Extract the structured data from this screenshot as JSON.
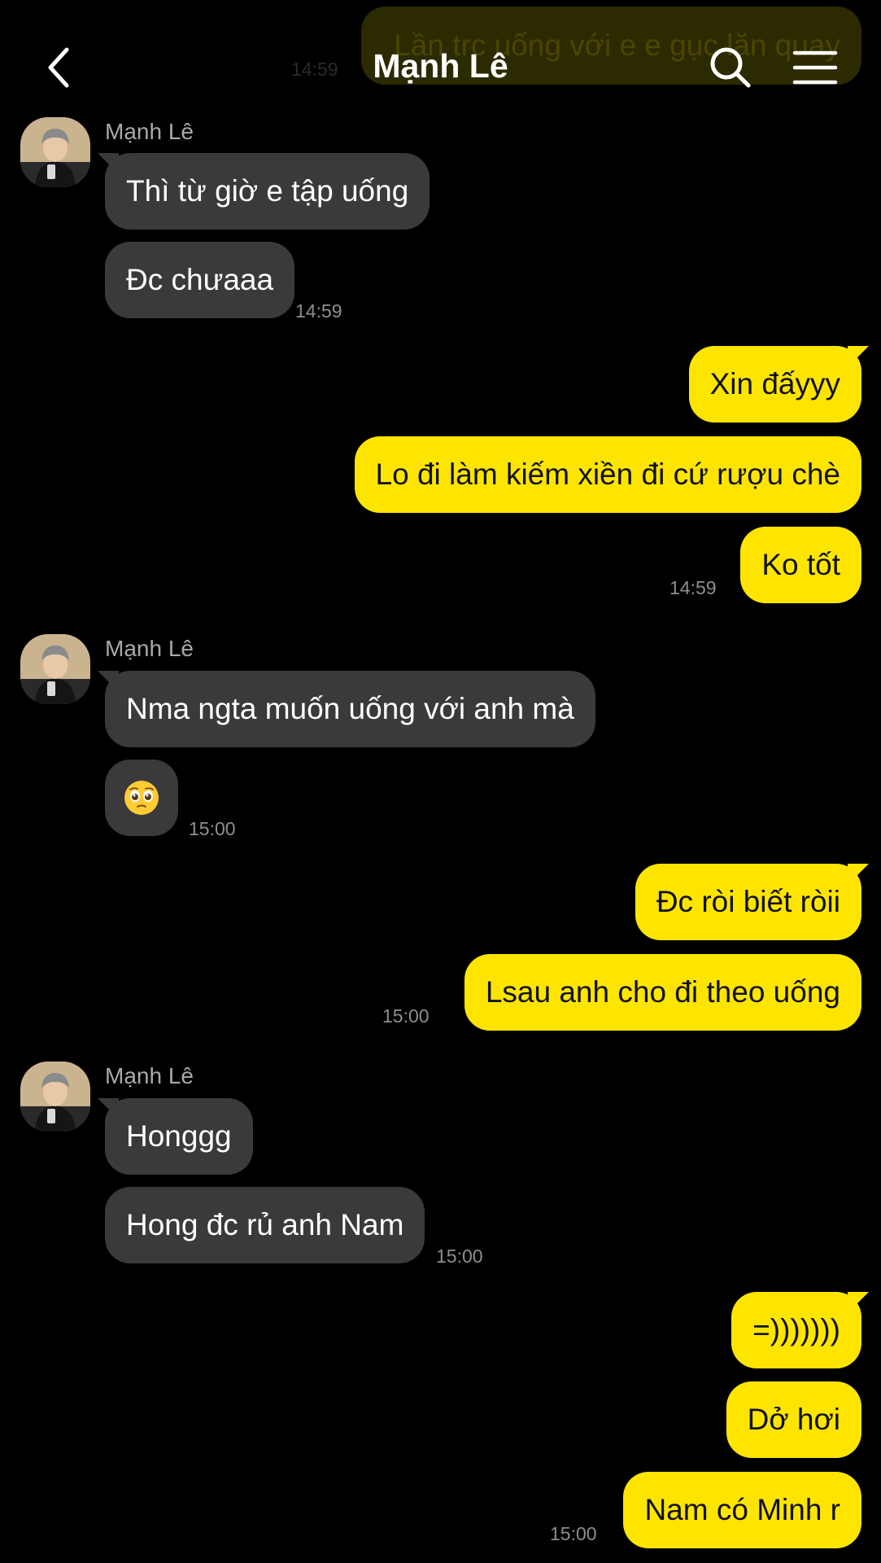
{
  "header": {
    "title": "Mạnh Lê",
    "back_icon": "chevron-left-icon",
    "search_icon": "search-icon",
    "menu_icon": "hamburger-menu-icon"
  },
  "previous_message": {
    "text": "Lần trc uống với e e gục lăn quay",
    "time": "14:59"
  },
  "colors": {
    "background": "#000000",
    "incoming_bubble": "#3a3a3c",
    "outgoing_bubble": "#fee500",
    "timestamp": "#8e8e93"
  },
  "groups": [
    {
      "sender": "Mạnh Lê",
      "messages": [
        "Thì từ giờ e tập uống",
        "Đc chưaaa"
      ],
      "time": "14:59"
    },
    {
      "messages": [
        "Xin đấyyy",
        "Lo đi làm kiếm xiền đi cứ rượu chè",
        "Ko tốt"
      ],
      "time": "14:59"
    },
    {
      "sender": "Mạnh Lê",
      "messages": [
        "Nma ngta muốn uống với anh mà",
        "🥺"
      ],
      "time": "15:00"
    },
    {
      "messages": [
        "Đc ròi biết ròii",
        "Lsau anh cho đi theo uống"
      ],
      "time": "15:00"
    },
    {
      "sender": "Mạnh Lê",
      "messages": [
        "Honggg",
        "Hong đc rủ anh Nam"
      ],
      "time": "15:00"
    },
    {
      "messages": [
        "=)))))))",
        "Dở hơi",
        "Nam có Minh r"
      ],
      "time": "15:00"
    }
  ]
}
